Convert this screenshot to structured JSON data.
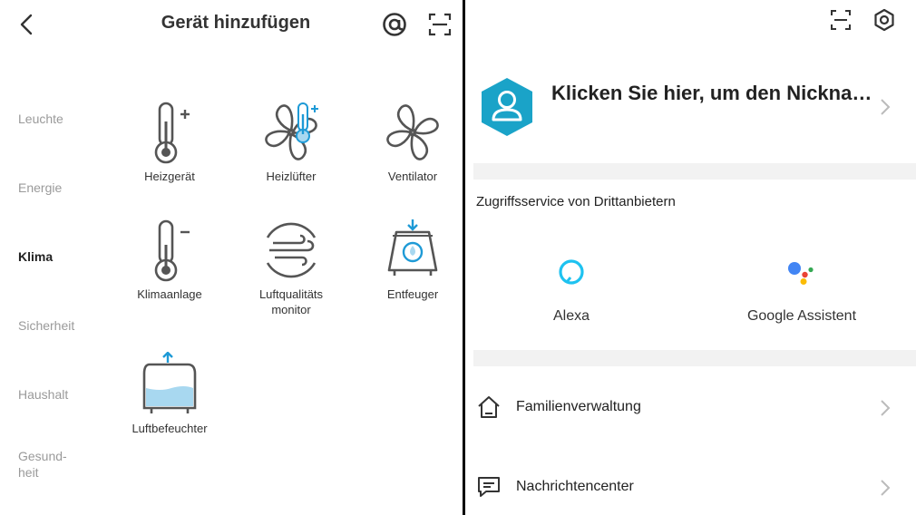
{
  "left": {
    "title": "Gerät hinzufügen",
    "categories": [
      {
        "label": "Leuchte"
      },
      {
        "label": "Energie"
      },
      {
        "label": "Klima"
      },
      {
        "label": "Sicherheit"
      },
      {
        "label": "Haushalt"
      },
      {
        "label": "Gesund-heit"
      }
    ],
    "devices": [
      {
        "label": "Heizgerät",
        "icon": "heater-icon"
      },
      {
        "label": "Heizlüfter",
        "icon": "fan-heater-icon"
      },
      {
        "label": "Ventilator",
        "icon": "fan-icon"
      },
      {
        "label": "Klimaanlage",
        "icon": "air-conditioner-icon"
      },
      {
        "label": "Luftqualitäts monitor",
        "icon": "air-quality-monitor-icon"
      },
      {
        "label": "Entfeuger",
        "icon": "dehumidifier-icon"
      },
      {
        "label": "Luftbefeuchter",
        "icon": "humidifier-icon"
      }
    ]
  },
  "right": {
    "profile_name": "Klicken Sie hier, um den Nickname festzulegen",
    "third_party_title": "Zugriffsservice von Drittanbietern",
    "services": [
      {
        "label": "Alexa",
        "icon": "alexa-icon"
      },
      {
        "label": "Google Assistent",
        "icon": "google-assistant-icon"
      }
    ],
    "menu": [
      {
        "label": "Familienverwaltung",
        "icon": "home-icon"
      },
      {
        "label": "Nachrichtencenter",
        "icon": "message-icon"
      }
    ]
  },
  "colors": {
    "accent_blue": "#1e9ad6",
    "water_blue": "#a8d8f0",
    "icon_gray": "#555555"
  }
}
